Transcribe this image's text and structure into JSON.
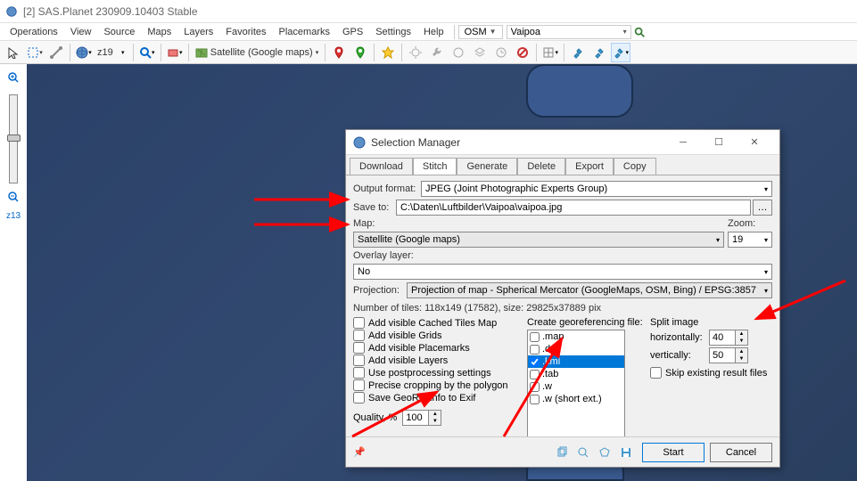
{
  "app": {
    "title": "[2] SAS.Planet 230909.10403 Stable"
  },
  "menu": {
    "items": [
      "Operations",
      "View",
      "Source",
      "Maps",
      "Layers",
      "Favorites",
      "Placemarks",
      "GPS",
      "Settings",
      "Help"
    ],
    "osm": "OSM",
    "search_value": "Vaipoa"
  },
  "toolbar": {
    "zoom": "z19",
    "map_name": "Satellite (Google maps)"
  },
  "side": {
    "zoom": "z13"
  },
  "dialog": {
    "title": "Selection Manager",
    "tabs": [
      "Download",
      "Stitch",
      "Generate",
      "Delete",
      "Export",
      "Copy"
    ],
    "labels": {
      "output_format": "Output format:",
      "save_to": "Save to:",
      "map": "Map:",
      "zoom": "Zoom:",
      "overlay": "Overlay layer:",
      "projection": "Projection:",
      "tiles_info": "Number of tiles: 118x149 (17582), size: 29825x37889 pix",
      "georef_title": "Create georeferencing file:",
      "split_title": "Split image",
      "horiz": "horizontally:",
      "vert": "vertically:",
      "skip": "Skip existing result files",
      "quality": "Quality, %"
    },
    "values": {
      "output_format": "JPEG (Joint Photographic Experts Group)",
      "save_to": "C:\\Daten\\Luftbilder\\Vaipoa\\vaipoa.jpg",
      "map": "Satellite (Google maps)",
      "zoom": "19",
      "overlay": "No",
      "projection": "Projection of map - Spherical Mercator (GoogleMaps, OSM, Bing) / EPSG:3857",
      "quality": "100",
      "horiz": "40",
      "vert": "50"
    },
    "checks": {
      "cached": "Add visible Cached Tiles Map",
      "grids": "Add visible Grids",
      "placemarks": "Add visible Placemarks",
      "layers": "Add visible Layers",
      "postproc": "Use postprocessing settings",
      "precise": "Precise cropping by the polygon",
      "georef_exif": "Save GeoRef info to Exif"
    },
    "georef": [
      ".map",
      ".dat",
      ".kml",
      ".tab",
      ".w",
      ".w (short ext.)"
    ],
    "buttons": {
      "start": "Start",
      "cancel": "Cancel"
    }
  }
}
